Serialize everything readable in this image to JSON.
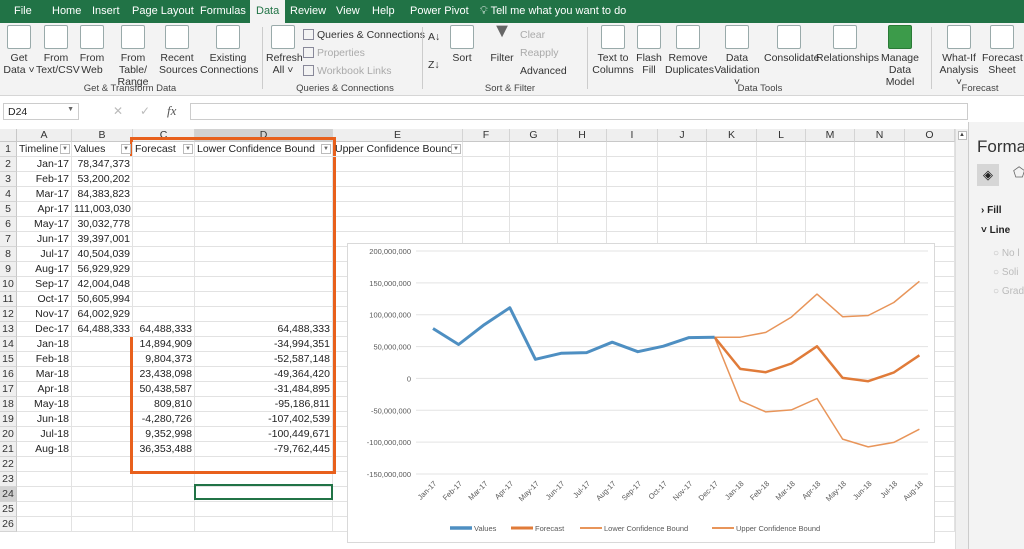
{
  "tabs": [
    "File",
    "Home",
    "Insert",
    "Page Layout",
    "Formulas",
    "Data",
    "Review",
    "View",
    "Help",
    "Power Pivot"
  ],
  "active_tab": "Data",
  "tell_me": "Tell me what you want to do",
  "ribbon": {
    "get_data": "Get Data ˅",
    "from_text": "From Text/CSV",
    "from_web": "From Web",
    "from_table": "From Table/ Range",
    "recent": "Recent Sources",
    "existing": "Existing Connections",
    "group_get": "Get & Transform Data",
    "refresh": "Refresh All ˅",
    "queries": "Queries & Connections",
    "properties": "Properties",
    "links": "Workbook Links",
    "group_queries": "Queries & Connections",
    "sort": "Sort",
    "filter": "Filter",
    "clear": "Clear",
    "reapply": "Reapply",
    "advanced": "Advanced",
    "group_sort": "Sort & Filter",
    "text_to_columns": "Text to Columns",
    "flash_fill": "Flash Fill",
    "remove_dup": "Remove Duplicates",
    "validation": "Data Validation ˅",
    "consolidate": "Consolidate",
    "relationships": "Relationships",
    "manage_model": "Manage Data Model",
    "group_tools": "Data Tools",
    "whatif": "What-If Analysis ˅",
    "forecast_sheet": "Forecast Sheet",
    "group_forecast": "Forecast"
  },
  "name_box": "D24",
  "fx": "fx",
  "columns": [
    "A",
    "B",
    "C",
    "D",
    "E",
    "F",
    "G",
    "H",
    "I",
    "J",
    "K",
    "L",
    "M",
    "N",
    "O"
  ],
  "headers": {
    "A": "Timeline",
    "B": "Values",
    "C": "Forecast",
    "D": "Lower Confidence Bound",
    "E": "Upper Confidence Bound"
  },
  "rows": [
    [
      "Jan-17",
      "78,347,373",
      "",
      ""
    ],
    [
      "Feb-17",
      "53,200,202",
      "",
      ""
    ],
    [
      "Mar-17",
      "84,383,823",
      "",
      ""
    ],
    [
      "Apr-17",
      "111,003,030",
      "",
      ""
    ],
    [
      "May-17",
      "30,032,778",
      "",
      ""
    ],
    [
      "Jun-17",
      "39,397,001",
      "",
      ""
    ],
    [
      "Jul-17",
      "40,504,039",
      "",
      ""
    ],
    [
      "Aug-17",
      "56,929,929",
      "",
      ""
    ],
    [
      "Sep-17",
      "42,004,048",
      "",
      ""
    ],
    [
      "Oct-17",
      "50,605,994",
      "",
      ""
    ],
    [
      "Nov-17",
      "64,002,929",
      "",
      ""
    ],
    [
      "Dec-17",
      "64,488,333",
      "64,488,333",
      "64,488,333"
    ],
    [
      "Jan-18",
      "",
      "14,894,909",
      "-34,994,351"
    ],
    [
      "Feb-18",
      "",
      "9,804,373",
      "-52,587,148"
    ],
    [
      "Mar-18",
      "",
      "23,438,098",
      "-49,364,420"
    ],
    [
      "Apr-18",
      "",
      "50,438,587",
      "-31,484,895"
    ],
    [
      "May-18",
      "",
      "809,810",
      "-95,186,811"
    ],
    [
      "Jun-18",
      "",
      "-4,280,726",
      "-107,402,539"
    ],
    [
      "Jul-18",
      "",
      "9,352,998",
      "-100,449,671"
    ],
    [
      "Aug-18",
      "",
      "36,353,488",
      "-79,762,445"
    ]
  ],
  "row_count": 26,
  "format_pane": {
    "title": "Format",
    "fill": "Fill",
    "line": "Line",
    "opts": [
      "No l",
      "Soli",
      "Grad"
    ]
  },
  "chart_data": {
    "type": "line",
    "categories": [
      "Jan-17",
      "Feb-17",
      "Mar-17",
      "Apr-17",
      "May-17",
      "Jun-17",
      "Jul-17",
      "Aug-17",
      "Sep-17",
      "Oct-17",
      "Nov-17",
      "Dec-17",
      "Jan-18",
      "Feb-18",
      "Mar-18",
      "Apr-18",
      "May-18",
      "Jun-18",
      "Jul-18",
      "Aug-18"
    ],
    "ylim": [
      -150000000,
      200000000
    ],
    "yticks": [
      "200,000,000",
      "150,000,000",
      "100,000,000",
      "50,000,000",
      "0",
      "-50,000,000",
      "-100,000,000",
      "-150,000,000"
    ],
    "series": [
      {
        "name": "Values",
        "color": "#4e8fc2",
        "width": 3,
        "values": [
          78347373,
          53200202,
          84383823,
          111003030,
          30032778,
          39397001,
          40504039,
          56929929,
          42004048,
          50605994,
          64002929,
          64488333,
          null,
          null,
          null,
          null,
          null,
          null,
          null,
          null
        ]
      },
      {
        "name": "Forecast",
        "color": "#e07b39",
        "width": 2.5,
        "values": [
          null,
          null,
          null,
          null,
          null,
          null,
          null,
          null,
          null,
          null,
          null,
          64488333,
          14894909,
          9804373,
          23438098,
          50438587,
          809810,
          -4280726,
          9352998,
          36353488
        ]
      },
      {
        "name": "Lower Confidence Bound",
        "color": "#e8955a",
        "width": 1.5,
        "values": [
          null,
          null,
          null,
          null,
          null,
          null,
          null,
          null,
          null,
          null,
          null,
          64488333,
          -34994351,
          -52587148,
          -49364420,
          -31484895,
          -95186811,
          -107402539,
          -100449671,
          -79762445
        ]
      },
      {
        "name": "Upper Confidence Bound",
        "color": "#e8955a",
        "width": 1.5,
        "values": [
          null,
          null,
          null,
          null,
          null,
          null,
          null,
          null,
          null,
          null,
          null,
          64488333,
          64784169,
          72195894,
          96240616,
          132362069,
          96806431,
          98841087,
          119155667,
          152469421
        ]
      }
    ],
    "legend": "bottom"
  }
}
